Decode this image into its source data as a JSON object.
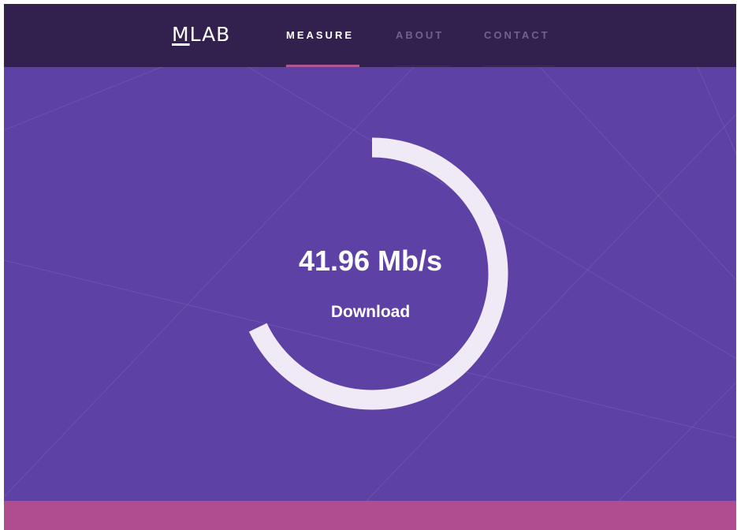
{
  "brand": {
    "logo_first": "M",
    "logo_rest": "LAB"
  },
  "nav": {
    "items": [
      {
        "label": "MEASURE",
        "active": true
      },
      {
        "label": "ABOUT",
        "active": false
      },
      {
        "label": "CONTACT",
        "active": false
      }
    ]
  },
  "test": {
    "value": "41.96 Mb/s",
    "label": "Download",
    "progress": 0.68
  },
  "colors": {
    "navbar": "#32214f",
    "hero": "#5e41a5",
    "gauge": "#efeaf6",
    "accent": "#b05594",
    "footer": "#b04d91"
  }
}
